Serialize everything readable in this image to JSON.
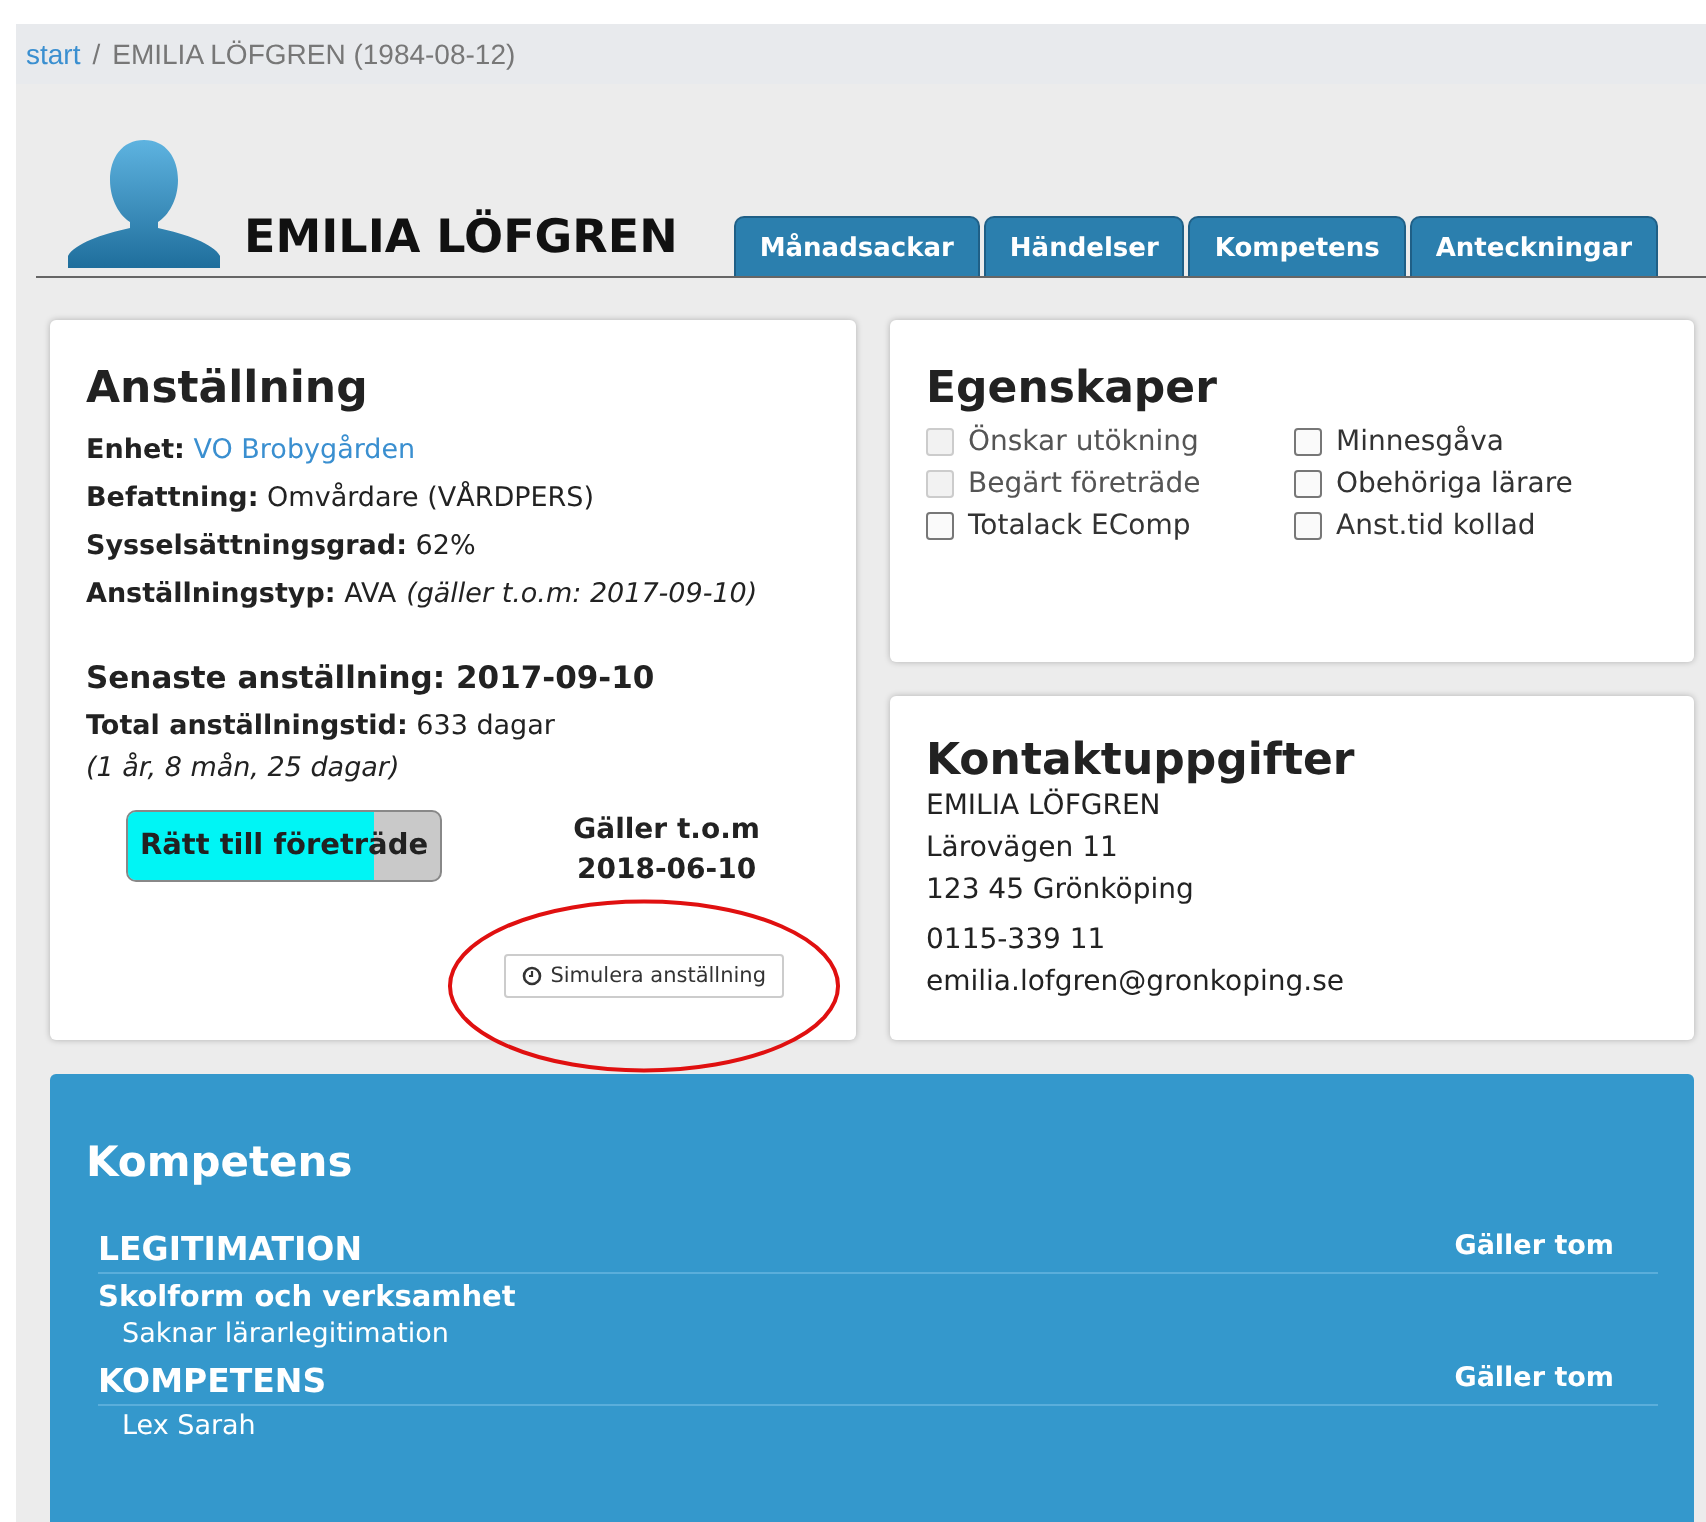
{
  "breadcrumb": {
    "link": "start",
    "separator": "/",
    "current": "EMILIA LÖFGREN (1984-08-12)"
  },
  "person": {
    "name": "EMILIA LÖFGREN"
  },
  "tabs": [
    {
      "label": "Månadsackar"
    },
    {
      "label": "Händelser"
    },
    {
      "label": "Kompetens"
    },
    {
      "label": "Anteckningar"
    }
  ],
  "employment": {
    "title": "Anställning",
    "fields": [
      {
        "label": "Enhet:",
        "value": "VO Brobygården",
        "kind": "link"
      },
      {
        "label": "Befattning:",
        "value": "Omvårdare (VÅRDPERS)",
        "kind": "text"
      },
      {
        "label": "Sysselsättningsgrad:",
        "value": "62%",
        "kind": "text"
      },
      {
        "label": "Anställningstyp:",
        "value": "AVA",
        "note": "(gäller t.o.m: 2017-09-10)",
        "kind": "text"
      }
    ],
    "latest": "Senaste anställning: 2017-09-10",
    "total_label": "Total anställningstid:",
    "total_value": "633 dagar",
    "total_detail": "(1 år, 8 mån, 25 dagar)",
    "preference": {
      "label": "Rätt till företräde",
      "level": 0.79
    },
    "valid_label": "Gäller t.o.m",
    "valid_date": "2018-06-10",
    "simulate_button": "Simulera anställning"
  },
  "properties": {
    "title": "Egenskaper",
    "items": [
      {
        "label": "Önskar utökning",
        "checked": false,
        "disabled": true
      },
      {
        "label": "Minnesgåva",
        "checked": false,
        "disabled": false
      },
      {
        "label": "Begärt företräde",
        "checked": false,
        "disabled": true
      },
      {
        "label": "Obehöriga lärare",
        "checked": false,
        "disabled": false
      },
      {
        "label": "Totalack EComp",
        "checked": false,
        "disabled": false
      },
      {
        "label": "Anst.tid kollad",
        "checked": false,
        "disabled": false
      }
    ]
  },
  "contact": {
    "title": "Kontaktuppgifter",
    "name": "EMILIA LÖFGREN",
    "street": "Lärovägen 11",
    "city": "123 45 Grönköping",
    "phone": "0115-339 11",
    "email": "emilia.lofgren@gronkoping.se"
  },
  "competence": {
    "title": "Kompetens",
    "sections": [
      {
        "heading": "LEGITIMATION",
        "column": "Gäller tom",
        "groups": [
          {
            "title": "Skolform och verksamhet",
            "items": [
              "Saknar lärarlegitimation"
            ]
          }
        ]
      },
      {
        "heading": "KOMPETENS",
        "column": "Gäller tom",
        "groups": [
          {
            "items": [
              "Lex Sarah"
            ]
          }
        ]
      }
    ]
  }
}
